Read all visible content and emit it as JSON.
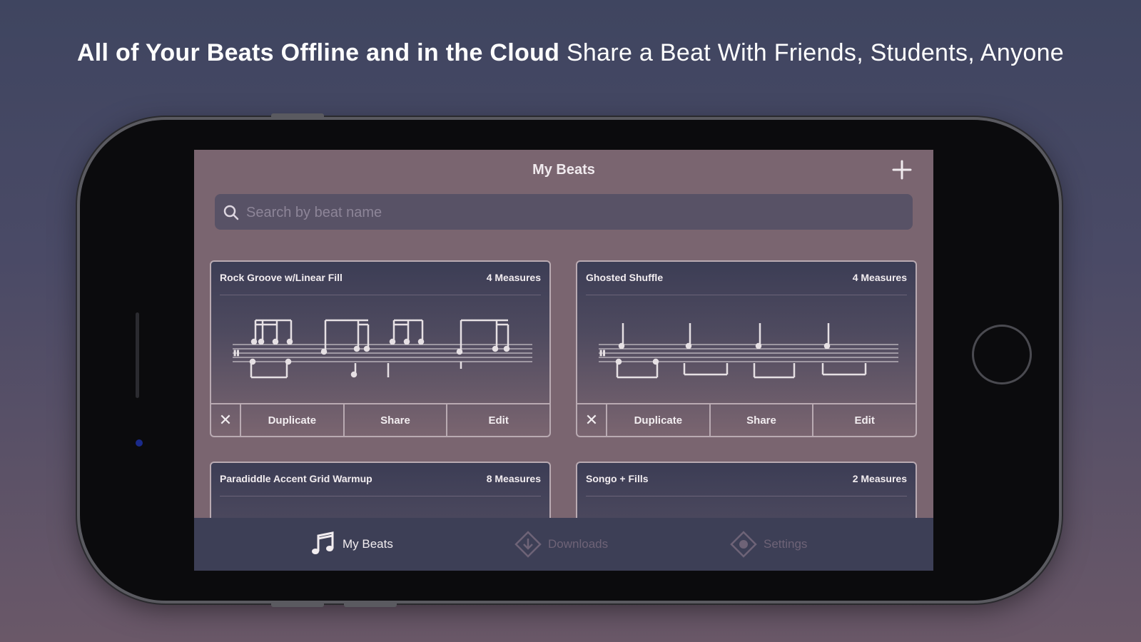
{
  "headline": {
    "bold": "All of Your Beats Offline and in the Cloud",
    "regular": "Share a Beat With Friends, Students, Anyone"
  },
  "screen": {
    "title": "My Beats",
    "add_icon": "plus-icon",
    "search": {
      "placeholder": "Search by beat name",
      "value": ""
    },
    "cards": [
      {
        "name": "Rock Groove w/Linear Fill",
        "measures": "4 Measures",
        "actions": [
          "Duplicate",
          "Share",
          "Edit"
        ]
      },
      {
        "name": "Ghosted Shuffle",
        "measures": "4 Measures",
        "actions": [
          "Duplicate",
          "Share",
          "Edit"
        ]
      },
      {
        "name": "Paradiddle Accent Grid Warmup",
        "measures": "8 Measures"
      },
      {
        "name": "Songo + Fills",
        "measures": "2 Measures"
      }
    ],
    "tabs": [
      {
        "label": "My Beats",
        "icon": "music-note-icon",
        "active": true
      },
      {
        "label": "Downloads",
        "icon": "download-icon",
        "active": false
      },
      {
        "label": "Settings",
        "icon": "settings-icon",
        "active": false
      }
    ]
  },
  "colors": {
    "background_top": "#3f4560",
    "background_bottom": "#6a5868",
    "screen_bg": "#7a6570",
    "card_border": "#b9aab2",
    "tabbar_bg": "#3d3f56"
  }
}
